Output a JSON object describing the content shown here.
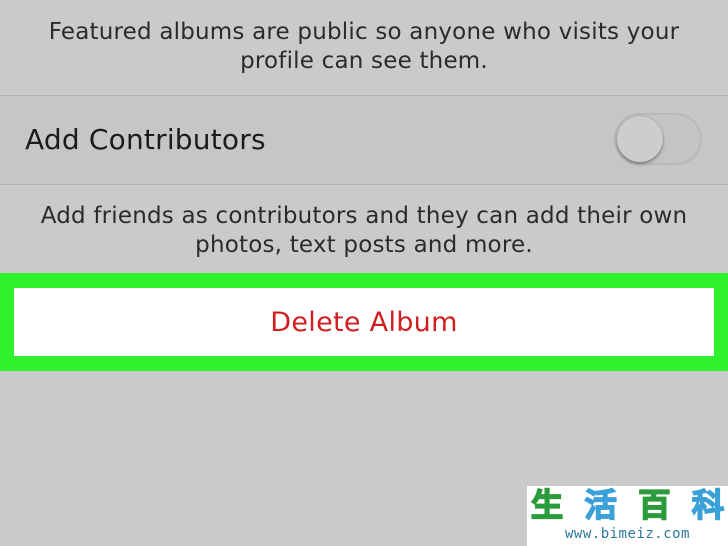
{
  "featured": {
    "description": "Featured albums are public so anyone who visits your profile can see them."
  },
  "contributors": {
    "label": "Add Contributors",
    "toggle_on": false,
    "description": "Add friends as contributors and they can add their own photos, text posts and more."
  },
  "actions": {
    "delete_label": "Delete Album"
  },
  "colors": {
    "highlight": "#2ff02c",
    "destructive": "#d01f1f",
    "background": "#cacaca"
  },
  "watermark": {
    "chars": [
      "生",
      "活",
      "百",
      "科"
    ],
    "url": "www.bimeiz.com"
  }
}
